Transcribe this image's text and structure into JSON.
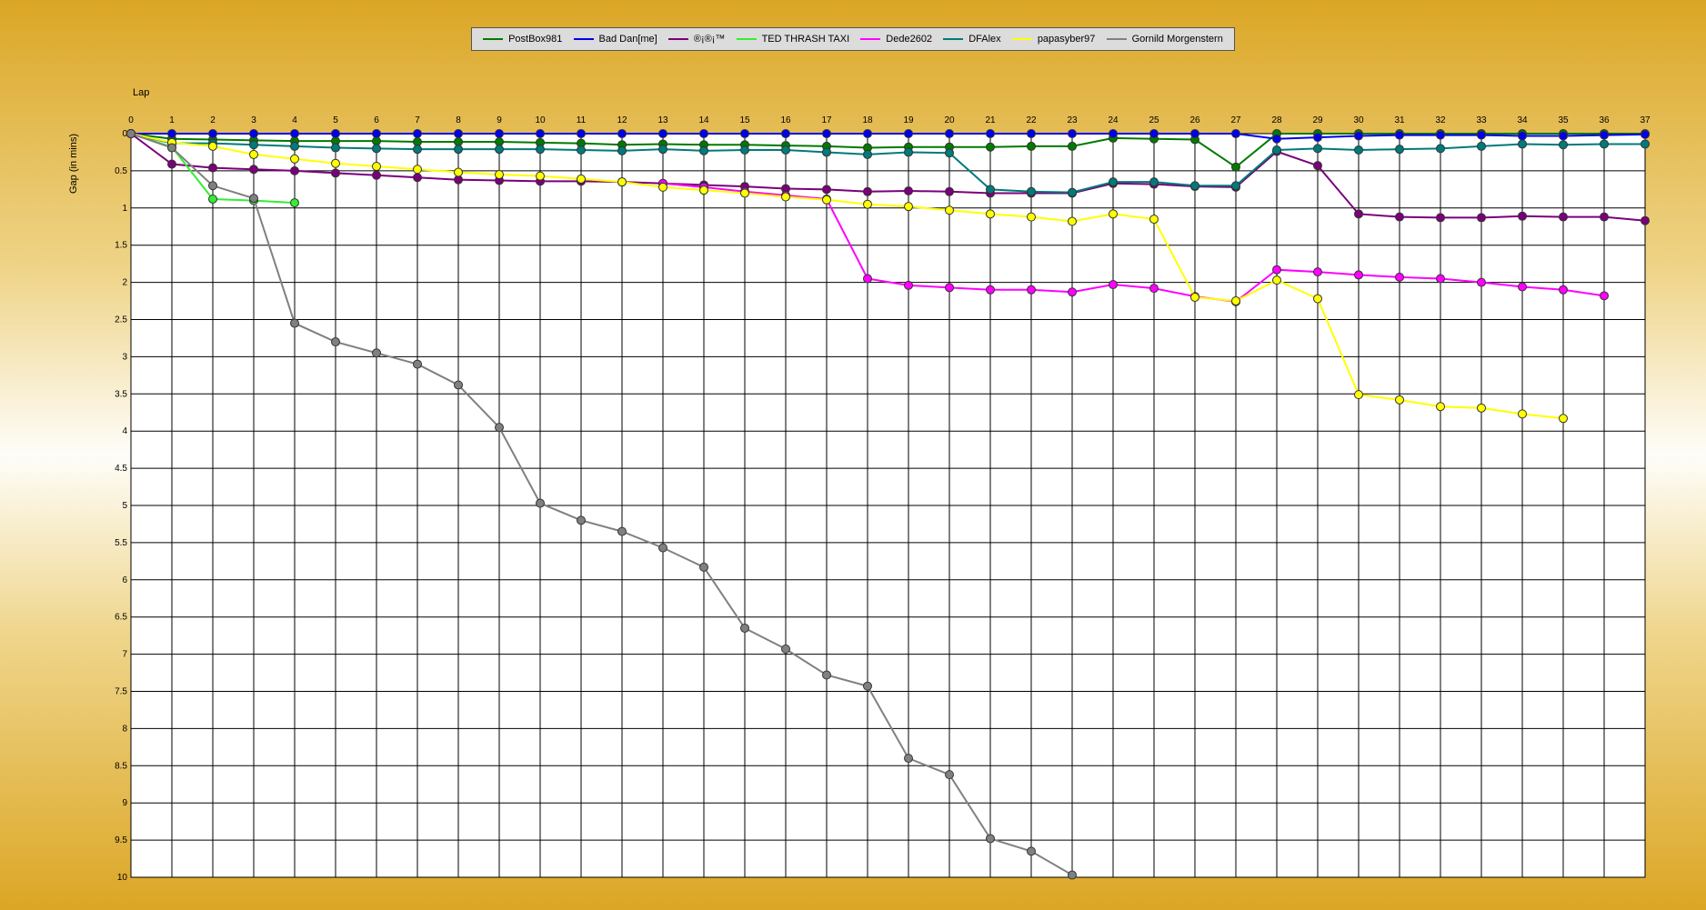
{
  "chart_data": {
    "type": "line",
    "xlabel": "Lap",
    "ylabel": "Gap (in mins)",
    "xlim": [
      0,
      37
    ],
    "ylim": [
      0,
      10
    ],
    "y_inverted": true,
    "grid": true,
    "legend_position": "top-center",
    "x_ticks": [
      0,
      1,
      2,
      3,
      4,
      5,
      6,
      7,
      8,
      9,
      10,
      11,
      12,
      13,
      14,
      15,
      16,
      17,
      18,
      19,
      20,
      21,
      22,
      23,
      24,
      25,
      26,
      27,
      28,
      29,
      30,
      31,
      32,
      33,
      34,
      35,
      36,
      37
    ],
    "y_ticks": [
      "0",
      "0.5",
      "1",
      "1.5",
      "2",
      "2.5",
      "3",
      "3.5",
      "4",
      "4.5",
      "5",
      "5.5",
      "6",
      "6.5",
      "7",
      "7.5",
      "8",
      "8.5",
      "9",
      "9.5",
      "10"
    ],
    "series": [
      {
        "name": "PostBox981",
        "color": "#007a00",
        "values": [
          0,
          0.07,
          0.08,
          0.09,
          0.1,
          0.1,
          0.1,
          0.11,
          0.11,
          0.11,
          0.12,
          0.13,
          0.15,
          0.14,
          0.15,
          0.15,
          0.16,
          0.17,
          0.19,
          0.18,
          0.18,
          0.18,
          0.17,
          0.17,
          0.06,
          0.07,
          0.08,
          0.45,
          0.0,
          0.0,
          0.0,
          0.0,
          0.0,
          0.0,
          0.0,
          0.0,
          0.0,
          0.0
        ]
      },
      {
        "name": "Bad Dan[me]",
        "color": "#0000ee",
        "values": [
          0,
          0,
          0,
          0,
          0,
          0,
          0,
          0,
          0,
          0,
          0,
          0,
          0,
          0,
          0,
          0,
          0,
          0,
          0,
          0,
          0,
          0,
          0,
          0,
          0,
          0,
          0,
          0,
          0.07,
          0.05,
          0.03,
          0.02,
          0.02,
          0.02,
          0.03,
          0.03,
          0.02,
          0.01
        ]
      },
      {
        "name": "®¡®¡™",
        "color": "#7a007a",
        "values": [
          0,
          0.41,
          0.46,
          0.48,
          0.5,
          0.53,
          0.56,
          0.59,
          0.62,
          0.63,
          0.64,
          0.64,
          0.65,
          0.67,
          0.69,
          0.71,
          0.74,
          0.75,
          0.78,
          0.77,
          0.78,
          0.8,
          0.8,
          0.8,
          0.67,
          0.68,
          0.71,
          0.72,
          0.24,
          0.43,
          1.08,
          1.12,
          1.13,
          1.13,
          1.11,
          1.12,
          1.12,
          1.17
        ]
      },
      {
        "name": "TED THRASH TAXI",
        "color": "#33ee33",
        "values": [
          0,
          0.18,
          0.88,
          0.9,
          0.93
        ]
      },
      {
        "name": "Dede2602",
        "color": "#ff00ff",
        "values": [
          0,
          null,
          null,
          null,
          null,
          null,
          null,
          null,
          null,
          null,
          null,
          null,
          null,
          0.67,
          0.72,
          0.78,
          0.83,
          0.88,
          1.95,
          2.04,
          2.07,
          2.1,
          2.1,
          2.13,
          2.03,
          2.08,
          2.19,
          2.26,
          1.83,
          1.86,
          1.9,
          1.93,
          1.95,
          2.0,
          2.06,
          2.1,
          2.18
        ]
      },
      {
        "name": "DFAlex",
        "color": "#007a7a",
        "values": [
          0,
          0.13,
          0.13,
          0.15,
          0.17,
          0.19,
          0.2,
          0.21,
          0.21,
          0.21,
          0.21,
          0.22,
          0.23,
          0.21,
          0.23,
          0.22,
          0.22,
          0.25,
          0.28,
          0.25,
          0.26,
          0.75,
          0.78,
          0.79,
          0.65,
          0.65,
          0.7,
          0.7,
          0.22,
          0.2,
          0.22,
          0.21,
          0.2,
          0.17,
          0.14,
          0.15,
          0.14,
          0.14
        ]
      },
      {
        "name": "papasyber97",
        "color": "#ffff00",
        "values": [
          0,
          0.12,
          0.17,
          0.28,
          0.34,
          0.4,
          0.44,
          0.48,
          0.52,
          0.55,
          0.57,
          0.61,
          0.65,
          0.72,
          0.76,
          0.8,
          0.85,
          0.89,
          0.95,
          0.98,
          1.03,
          1.08,
          1.12,
          1.18,
          1.08,
          1.15,
          2.2,
          2.25,
          1.97,
          2.22,
          3.51,
          3.58,
          3.67,
          3.69,
          3.77,
          3.83
        ]
      },
      {
        "name": "Gornild Morgenstern",
        "color": "#808080",
        "values": [
          0,
          0.19,
          0.7,
          0.87,
          2.55,
          2.8,
          2.95,
          3.1,
          3.38,
          3.95,
          4.97,
          5.2,
          5.35,
          5.57,
          5.83,
          6.65,
          6.93,
          7.28,
          7.43,
          8.4,
          8.62,
          9.48,
          9.65,
          9.97
        ]
      }
    ]
  }
}
